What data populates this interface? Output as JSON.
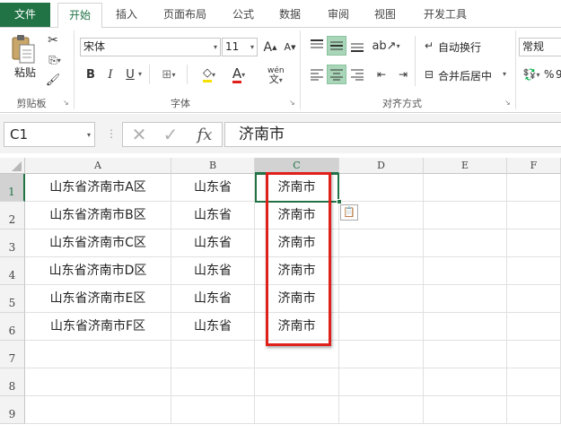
{
  "tabs": {
    "file": "文件",
    "home": "开始",
    "insert": "插入",
    "page_layout": "页面布局",
    "formulas": "公式",
    "data": "数据",
    "review": "审阅",
    "view": "视图",
    "developer": "开发工具"
  },
  "ribbon": {
    "clipboard": {
      "paste_label": "粘贴",
      "group_label": "剪贴板"
    },
    "font": {
      "font_name": "宋体",
      "font_size": "11",
      "bold": "B",
      "italic": "I",
      "underline": "U",
      "grow": "A",
      "shrink": "A",
      "wen": "wén",
      "font_color": "A",
      "group_label": "字体"
    },
    "alignment": {
      "wrap_text": "自动换行",
      "merge_center": "合并后居中",
      "group_label": "对齐方式"
    },
    "number": {
      "format": "常规",
      "percent": "%",
      "nine": "9"
    }
  },
  "formula_bar": {
    "name_box": "C1",
    "fx": "fx",
    "value": "济南市"
  },
  "columns": [
    "A",
    "B",
    "C",
    "D",
    "E",
    "F"
  ],
  "rows": [
    {
      "num": "1",
      "a": "山东省济南市A区",
      "b": "山东省",
      "c": "济南市"
    },
    {
      "num": "2",
      "a": "山东省济南市B区",
      "b": "山东省",
      "c": "济南市"
    },
    {
      "num": "3",
      "a": "山东省济南市C区",
      "b": "山东省",
      "c": "济南市"
    },
    {
      "num": "4",
      "a": "山东省济南市D区",
      "b": "山东省",
      "c": "济南市"
    },
    {
      "num": "5",
      "a": "山东省济南市E区",
      "b": "山东省",
      "c": "济南市"
    },
    {
      "num": "6",
      "a": "山东省济南市F区",
      "b": "山东省",
      "c": "济南市"
    },
    {
      "num": "7",
      "a": "",
      "b": "",
      "c": ""
    },
    {
      "num": "8",
      "a": "",
      "b": "",
      "c": ""
    },
    {
      "num": "9",
      "a": "",
      "b": "",
      "c": ""
    }
  ],
  "colors": {
    "accent": "#217346",
    "highlight": "#e0201b",
    "selected_align": "#a9d5b8"
  }
}
